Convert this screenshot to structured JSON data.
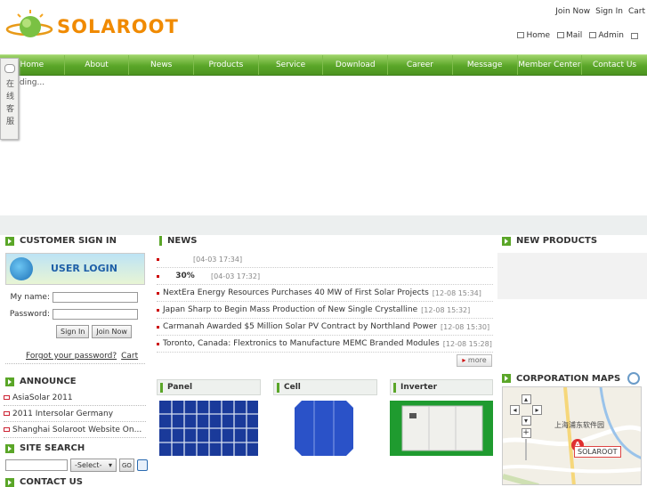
{
  "header": {
    "logo_text": "SOLAROOT",
    "top_links": [
      "Join Now",
      "Sign In",
      "Cart"
    ],
    "sub_links": [
      {
        "icon": "home-icon",
        "label": "Home"
      },
      {
        "icon": "mail-icon",
        "label": "Mail"
      },
      {
        "icon": "admin-icon",
        "label": "Admin"
      }
    ]
  },
  "nav": [
    "Home",
    "About",
    "News",
    "Products",
    "Service",
    "Download",
    "Career",
    "Message",
    "Member Center",
    "Contact Us"
  ],
  "loading_text": "Loading...",
  "kefu_text": "在线客服",
  "left": {
    "signin_title": "CUSTOMER SIGN IN",
    "banner_label": "USER LOGIN",
    "name_label": "My name:",
    "password_label": "Password:",
    "signin_button": "Sign In",
    "join_button": "Join Now",
    "forgot_link": "Forgot your password?",
    "cart_link": "Cart",
    "announce_title": "ANNOUNCE",
    "announcements": [
      "AsiaSolar 2011",
      "2011 Intersolar Germany",
      "Shanghai Solaroot Website On..."
    ],
    "search_title": "SITE SEARCH",
    "search_select": "-Select-",
    "search_go": "GO",
    "contact_title": "CONTACT US"
  },
  "news": {
    "title": "NEWS",
    "items": [
      {
        "title": "",
        "date": "[04-03 17:34]"
      },
      {
        "title": "30%",
        "date": "[04-03 17:32]"
      },
      {
        "title": "NextEra Energy Resources Purchases 40 MW of First Solar Projects",
        "date": "[12-08 15:34]"
      },
      {
        "title": "Japan Sharp to Begin Mass Production of New Single Crystalline",
        "date": "[12-08 15:32]"
      },
      {
        "title": "Carmanah Awarded $5 Million Solar PV Contract by Northland Power",
        "date": "[12-08 15:30]"
      },
      {
        "title": "Toronto, Canada: Flextronics to Manufacture MEMC Branded Modules",
        "date": "[12-08 15:28]"
      }
    ],
    "more": "more"
  },
  "products": [
    "Panel",
    "Cell",
    "Inverter"
  ],
  "right": {
    "newprod_title": "NEW PRODUCTS",
    "maps_title": "CORPORATION MAPS",
    "map_city": "上海浦东软件园",
    "map_marker": "SOLAROOT",
    "map_marker_letter": "A"
  }
}
